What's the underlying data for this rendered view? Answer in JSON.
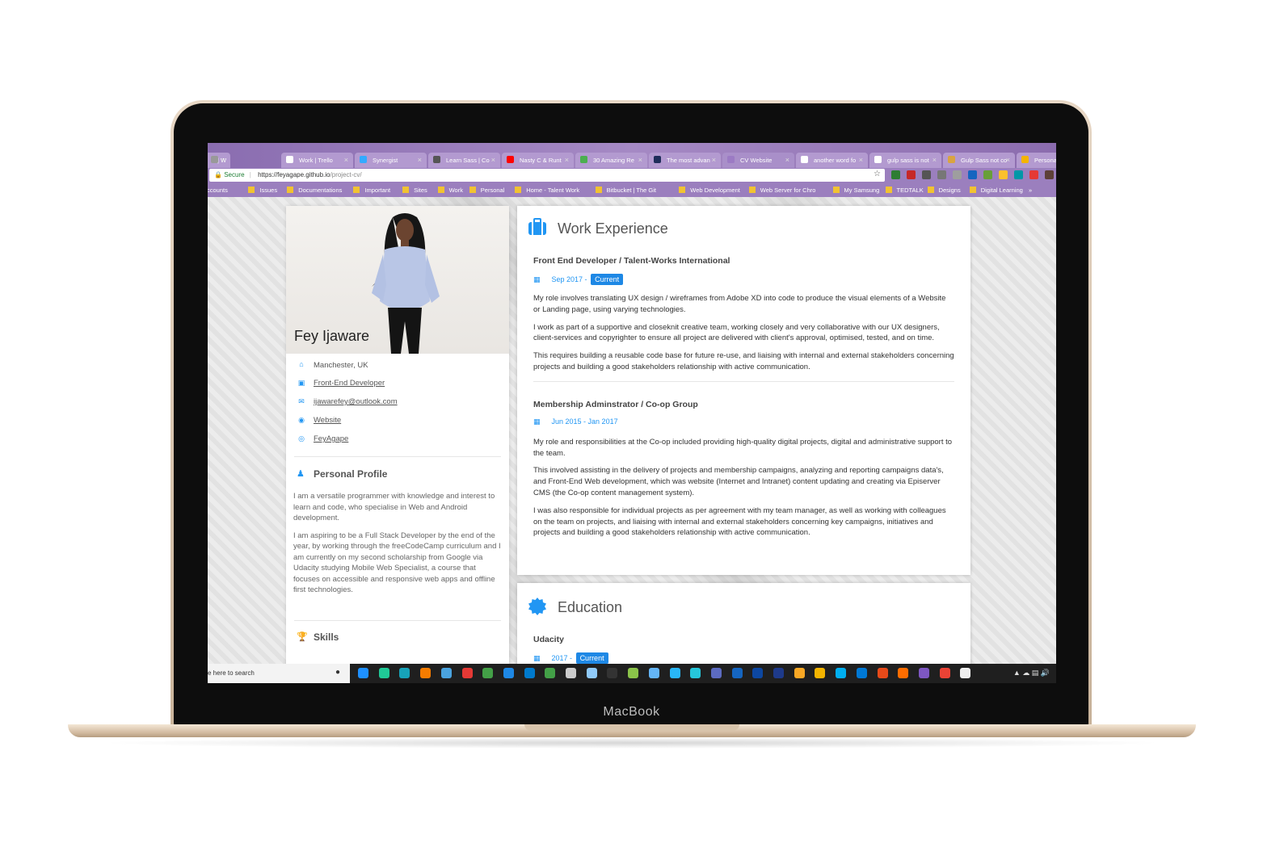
{
  "device": {
    "brand_label": "MacBook"
  },
  "browser": {
    "tabs": [
      {
        "label": "| W",
        "icon_color": "#999999"
      },
      {
        "label": "Work | Trello",
        "icon_color": "#ffffff"
      },
      {
        "label": "Synergist",
        "icon_color": "#33aaff"
      },
      {
        "label": "Learn Sass | Co",
        "icon_color": "#555555"
      },
      {
        "label": "Nasty C & Runt",
        "icon_color": "#ff0000"
      },
      {
        "label": "30 Amazing Re",
        "icon_color": "#4caf50"
      },
      {
        "label": "The most advan",
        "icon_color": "#1f2d5a"
      },
      {
        "label": "CV Website",
        "icon_color": "#9c7bc4"
      },
      {
        "label": "another word fo",
        "icon_color": "#ffffff"
      },
      {
        "label": "gulp sass is not",
        "icon_color": "#ffffff"
      },
      {
        "label": "Gulp Sass not co",
        "icon_color": "#d9a441"
      },
      {
        "label": "Personal Portfol",
        "icon_color": "#f4b400"
      }
    ],
    "address": {
      "secure_label": "Secure",
      "url_base": "https://feyagape.github.io",
      "url_path": "/project-cv/"
    },
    "bookmarks": [
      "Accounts",
      "Issues",
      "Documentations",
      "Important",
      "Sites",
      "Work",
      "Personal",
      "Home - Talent Work",
      "Bitbucket | The Git",
      "Web Development",
      "Web Server for Chro",
      "My Samsung",
      "TEDTALK",
      "Designs",
      "Digital Learning",
      "»"
    ]
  },
  "profile": {
    "name": "Fey Ijaware",
    "location": "Manchester, UK",
    "role": "Front-End Developer",
    "email": "ijawarefey@outlook.com",
    "website": "Website",
    "github": "FeyAgape",
    "personal_profile_title": "Personal Profile",
    "profile_paragraphs": [
      "I am a versatile programmer with knowledge and interest to learn and code, who specialise in Web and Android development.",
      "I am aspiring to be a Full Stack Developer by the end of the year, by working through the freeCodeCamp curriculum and I am currently on my second scholarship from Google via Udacity studying Mobile Web Specialist, a course that focuses on accessible and responsive web apps and offline first technologies."
    ],
    "skills_title": "Skills"
  },
  "work": {
    "title": "Work Experience",
    "jobs": [
      {
        "title": "Front End Developer / Talent-Works International",
        "date": "Sep 2017 -",
        "badge": "Current",
        "paragraphs": [
          "My role involves translating UX design / wireframes from Adobe XD into code to produce the visual elements of a Website or Landing page, using varying technologies.",
          "I work as part of a supportive and closeknit creative team, working closely and very collaborative with our UX designers, client-services and copyrighter to ensure all project are delivered with client's approval, optimised, tested, and on time.",
          "This requires building a reusable code base for future re-use, and liaising with internal and external stakeholders concerning projects and building a good stakeholders relationship with active communication."
        ]
      },
      {
        "title": "Membership Adminstrator / Co-op Group",
        "date": "Jun 2015 - Jan 2017",
        "badge": "",
        "paragraphs": [
          "My role and responsibilities at the Co-op included providing high-quality digital projects, digital and administrative support to the team.",
          "This involved assisting in the delivery of projects and membership campaigns, analyzing and reporting campaigns data's, and Front-End Web development, which was website (Internet and Intranet) content updating and creating via Episerver CMS (the Co-op content management system).",
          "I was also responsible for individual projects as per agreement with my team manager, as well as working with colleagues on the team on projects, and liaising with internal and external stakeholders concerning key campaigns, initiatives and projects and building a good stakeholders relationship with active communication."
        ]
      }
    ]
  },
  "education": {
    "title": "Education",
    "entries": [
      {
        "school": "Udacity",
        "date": "2017 -",
        "badge": "Current"
      }
    ]
  },
  "taskbar": {
    "search_placeholder": "e here to search",
    "icon_colors": [
      "#1e90ff",
      "#20c997",
      "#17a2b8",
      "#f57c00",
      "#4aa3df",
      "#e53935",
      "#43a047",
      "#1e88e5",
      "#007acc",
      "#43a047",
      "#cccccc",
      "#90caf9",
      "#333333",
      "#8bc34a",
      "#64b5f6",
      "#29b6f6",
      "#26c6da",
      "#5c6bc0",
      "#1565c0",
      "#0d47a1",
      "#1e3a8a",
      "#f9a825",
      "#f4b400",
      "#00aff0",
      "#0078d4",
      "#e64a19",
      "#ff6d00",
      "#7e57c2",
      "#ea4335",
      "#eeeeee"
    ]
  },
  "colors": {
    "accent": "#2196f3",
    "badge": "#1e88e5",
    "tab_bar": "#9b7fbe"
  }
}
